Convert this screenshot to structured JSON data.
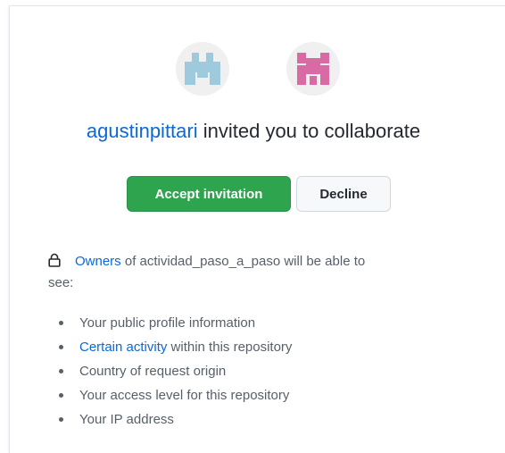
{
  "invitation": {
    "inviter": "agustinpittari",
    "headline_rest": " invited you to collaborate",
    "inviter_avatar_color": "#9fcadd",
    "repo_avatar_color": "#d86ba4"
  },
  "actions": {
    "accept_label": "Accept invitation",
    "decline_label": "Decline",
    "accept_color": "#2ea44f"
  },
  "notice": {
    "owners_link": "Owners",
    "text": " of actividad_paso_a_paso will be able to",
    "text_cont": "see:"
  },
  "shared_items": [
    {
      "label": "Your public profile information",
      "link": ""
    },
    {
      "label": "",
      "link": "Certain activity",
      "suffix": " within this repository"
    },
    {
      "label": "Country of request origin",
      "link": ""
    },
    {
      "label": "Your access level for this repository",
      "link": ""
    },
    {
      "label": "Your IP address",
      "link": ""
    }
  ],
  "icons": {
    "lock": "lock-icon"
  }
}
